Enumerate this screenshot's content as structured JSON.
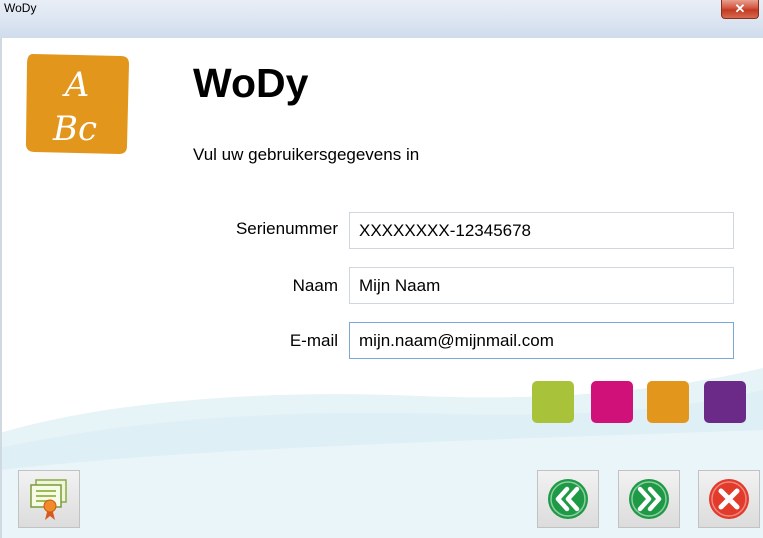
{
  "window": {
    "title": "WoDy",
    "close_glyph": "✕"
  },
  "header": {
    "logo_line1": "A",
    "logo_line2": "Bc",
    "title": "WoDy",
    "subtitle": "Vul uw gebruikersgegevens in"
  },
  "form": {
    "serial": {
      "label": "Serienummer",
      "value": "XXXXXXXX-12345678"
    },
    "name": {
      "label": "Naam",
      "value": "Mijn Naam"
    },
    "email": {
      "label": "E-mail",
      "value": "mijn.naam@mijnmail.com"
    }
  },
  "swatches": [
    {
      "name": "green",
      "color": "#a8c33a"
    },
    {
      "name": "magenta",
      "color": "#d0117a"
    },
    {
      "name": "orange",
      "color": "#e2961c"
    },
    {
      "name": "purple",
      "color": "#6b2a87"
    }
  ],
  "buttons": {
    "certificate": {
      "icon": "certificate-icon"
    },
    "back": {
      "icon": "double-chevron-left-icon",
      "color": "#1e9a46"
    },
    "next": {
      "icon": "double-chevron-right-icon",
      "color": "#1e9a46"
    },
    "cancel": {
      "icon": "close-x-icon",
      "color": "#e23a2b"
    }
  },
  "colors": {
    "logo_orange": "#e2961c",
    "wave": "#e4f2f6"
  }
}
